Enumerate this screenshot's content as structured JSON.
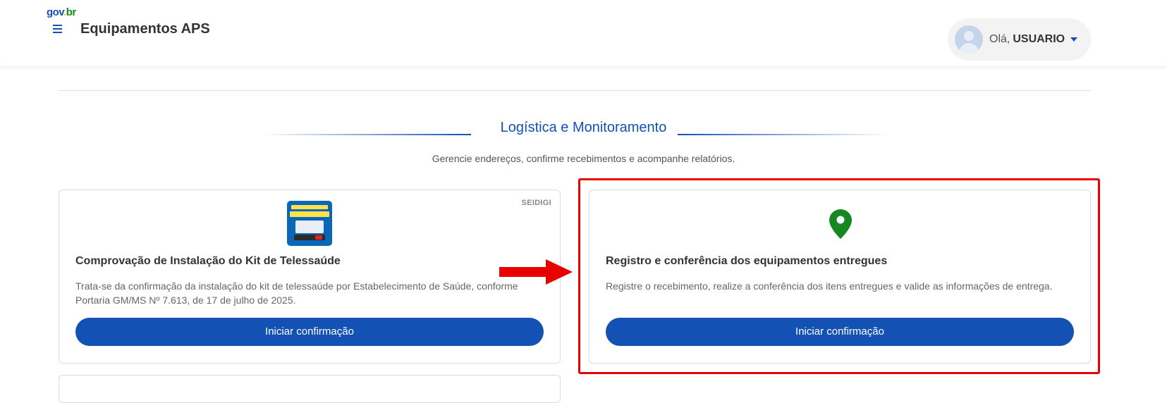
{
  "header": {
    "logo": {
      "g": "gov",
      "dot": ".",
      "br": "br"
    },
    "app_title": "Equipamentos APS",
    "user": {
      "greeting": "Olá,",
      "name": "USUARIO"
    }
  },
  "section": {
    "title": "Logística e Monitoramento",
    "subtitle": "Gerencie endereços, confirme recebimentos e acompanhe relatórios."
  },
  "cards": [
    {
      "badge": "SEIDIGI",
      "image": "telessaude-kit-thumbnail",
      "title": "Comprovação de Instalação do Kit de Telessaúde",
      "description": "Trata-se da confirmação da instalação do kit de telessaúde por Estabelecimento de Saúde, conforme Portaria GM/MS Nº 7.613, de 17 de julho de 2025.",
      "button": "Iniciar confirmação"
    },
    {
      "icon": "map-pin-icon",
      "title": "Registro e conferência dos equipamentos entregues",
      "description": "Registre o recebimento, realize a conferência dos itens entregues e valide as informações de entrega.",
      "button": "Iniciar confirmação"
    }
  ],
  "colors": {
    "primary": "#1351b4",
    "pin": "#168821",
    "highlight": "#e80000"
  }
}
